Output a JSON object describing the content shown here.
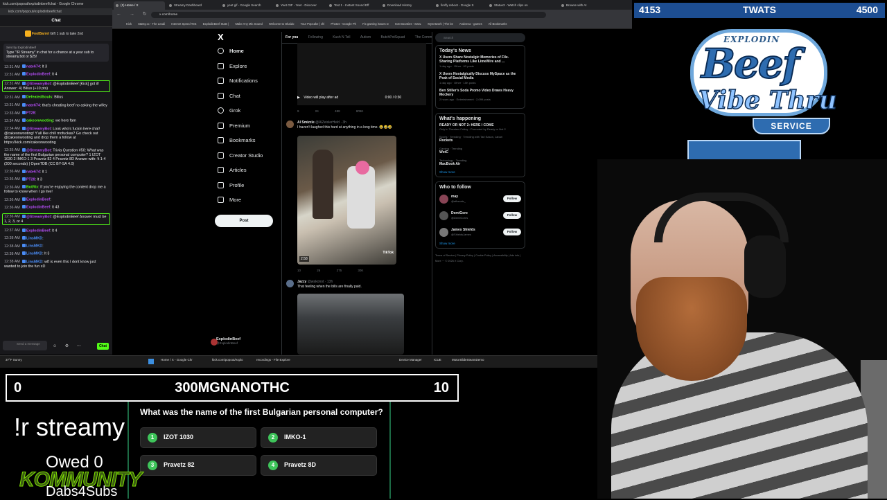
{
  "overlay": {
    "top_left_score": "4153",
    "top_title": "TWATS",
    "top_right_score": "4500",
    "logo": {
      "top": "EXPLODIN",
      "main": "Beef",
      "sub": "Vibe Thru",
      "service": "SERVICE"
    },
    "trivia_left_score": "0",
    "trivia_title": "300MGNANOTHC",
    "trivia_right_score": "10",
    "question": "What was the name of the first Bulgarian personal computer?",
    "answers": [
      {
        "num": "1",
        "text": "IZOT 1030"
      },
      {
        "num": "2",
        "text": "IMKO-1"
      },
      {
        "num": "3",
        "text": "Pravetz 82"
      },
      {
        "num": "4",
        "text": "Pravetz 8D"
      }
    ],
    "command": "!r streamy",
    "owed": "Owed 0",
    "kommunity": "KOMMUNITY",
    "dabs": "Dabs4Subs"
  },
  "chat_window": {
    "tab_title": "kick.com/popout/explodinbeef/chat - Google Chrome",
    "url": "kick.com/popout/explodinbeef/chat",
    "title": "Chat",
    "gift": {
      "user": "FoolBarrel",
      "text": "Gift 1 sub to take 2nd"
    },
    "pinned": {
      "by": "Sent by ExplodinBeef",
      "text": "Type \"!R Streamy\" in chat for a chance at a year sub to streamy.bot or $25!"
    },
    "messages": [
      {
        "time": "12:31 AM",
        "user": "nate674",
        "text": ": lt 3",
        "color": "#b14cf0"
      },
      {
        "time": "12:31 AM",
        "user": "ExplodinBeef",
        "text": ": lt 4",
        "color": "#b14cf0"
      },
      {
        "time": "12:31 AM",
        "user": "@StreamyBot",
        "text": ": @ExplodinBeef [Kick] got it! Answer: 4) Bilius (+10 pts)",
        "color": "#b14cf0"
      },
      {
        "time": "12:31 AM",
        "user": "DefeatedSouls",
        "text": ": Bilius",
        "color": "#53fc18"
      },
      {
        "time": "12:31 AM",
        "user": "nate674",
        "text": ": that's cheating beef no asking the wifey",
        "color": "#b14cf0"
      },
      {
        "time": "12:33 AM",
        "user": "PT28",
        "text": ":",
        "color": "#b14cf0"
      },
      {
        "time": "12:34 AM",
        "user": "cakeonwooting",
        "text": ": we here fam",
        "color": "#53fc18"
      },
      {
        "time": "12:34 AM",
        "user": "@StreamyBot",
        "text": ": Look who's fuckin here chat! @cakeonwooting! Y'all like chill mofuckas? Go check out @cakeonwooting and drop them a follow at https://kick.com/cakeonwooting",
        "color": "#b14cf0"
      },
      {
        "time": "12:35 AM",
        "user": "@StreamyBot",
        "text": ": Trivia Question #50: What was the name of the first Bulgarian personal computer? 1 IZOT 1030 2 IMKO-1 3 Pravetz 82 4 Pravetz 8D Answer with: !t 1-4 (300 seconds) | OpenTDB (CC BY-SA 4.0)",
        "color": "#b14cf0"
      },
      {
        "time": "12:36 AM",
        "user": "nate674",
        "text": ": lt 1",
        "color": "#b14cf0"
      },
      {
        "time": "12:36 AM",
        "user": "PT28",
        "text": ": lt 3",
        "color": "#b14cf0"
      },
      {
        "time": "12:36 AM",
        "user": "BotRix",
        "text": ": If you're enjoying the content drop me a follow to know when I go live!",
        "color": "#53fc18"
      },
      {
        "time": "12:36 AM",
        "user": "ExplodinBeef",
        "text": ":",
        "color": "#b14cf0"
      },
      {
        "time": "12:36 AM",
        "user": "ExplodinBeef",
        "text": ": lt 43",
        "color": "#b14cf0"
      },
      {
        "time": "12:36 AM",
        "user": "@StreamyBot",
        "text": ": @ExplodinBeef Answer must be 1, 2, 3, or 4",
        "color": "#b14cf0"
      },
      {
        "time": "12:37 AM",
        "user": "ExplodinBeef",
        "text": ": lt 4",
        "color": "#b14cf0"
      },
      {
        "time": "12:38 AM",
        "user": "LinsMKD",
        "text": ":",
        "color": "#4a8cf5"
      },
      {
        "time": "12:38 AM",
        "user": "LinsMKD",
        "text": ":",
        "color": "#4a8cf5"
      },
      {
        "time": "12:38 AM",
        "user": "LinsMKD",
        "text": ": lt 3",
        "color": "#4a8cf5"
      },
      {
        "time": "12:38 AM",
        "user": "LinsMKD",
        "text": ": wtf is even this I dont know just wanted to join the fun xD",
        "color": "#4a8cf5"
      }
    ],
    "input_placeholder": "Send a message",
    "chat_button": "Chat"
  },
  "browser": {
    "tabs": [
      "(1) Home / X",
      "Streamy Dashboard",
      "yeet gif - Google Search",
      "Yeet GIF - Yeet - Discover",
      "Test 1 - Instant Sound Eff",
      "Download History",
      "firefly reboot - Google S",
      "Statue3 - Watch clips on",
      "Browse with AI"
    ],
    "url": "x.com/home",
    "bookmarks": [
      "Kick",
      "Statsy.cc - The Leadi",
      "Internet Speed Test",
      "ExplodinBeef Stats |",
      "Make Any Mic Sound",
      "Welcome to Okaido",
      "Your Popcake | chl",
      "Photos - Google Ph",
      "Fix gaming issues w",
      "ICE Bounties - www.",
      "Mynetwork | The be",
      "Andeeva - games",
      "All Bookmarks"
    ]
  },
  "x_nav": {
    "logo": "X",
    "items": [
      "Home",
      "Explore",
      "Notifications",
      "Chat",
      "Grok",
      "Premium",
      "Bookmarks",
      "Creator Studio",
      "Articles",
      "Profile",
      "More"
    ],
    "post": "Post",
    "profile_name": "ExplodinBeef",
    "profile_handle": "@ExplodinBeef"
  },
  "feed": {
    "tabs": [
      "For you",
      "Following",
      "Kush N Tell",
      "Autism",
      "ButchPotSquad",
      "The Comm"
    ],
    "video_note": "Video will play after ad",
    "video_time": "0:00 / 0:30",
    "actions1": [
      "9",
      "24",
      "488",
      "805K"
    ],
    "tweet1": {
      "name": "Al Smizzle",
      "handle": "@AlZeislerHeld · 3h",
      "text": "I haven't laughed this hard at anything in a long time. 😂😂😂",
      "duration": "2:58",
      "tiktok": "TikTok"
    },
    "actions2": [
      "10",
      "26",
      "275",
      "30K"
    ],
    "tweet2": {
      "name": "Jazzy",
      "handle": "@wakonot · 13h",
      "text": "That feeling when the bills are finally paid."
    }
  },
  "right_col": {
    "search": "Search",
    "news_title": "Today's News",
    "news": [
      {
        "title": "X Users Share Nostalgic Memories of File-Sharing Platforms Like LimeWire and ...",
        "meta": "1 day ago · Other · 63 posts"
      },
      {
        "title": "X Users Nostalgically Discuss MySpace as the Peak of Social Media",
        "meta": "1 day ago · Other · 15K posts"
      },
      {
        "title": "Ben Stiller's Soda Promo Video Draws Heavy Mockery",
        "meta": "2 hours ago · Entertainment · 2,099 posts"
      }
    ],
    "happening_title": "What's happening",
    "trends": [
      {
        "sub": "Only in Theaters Friday · Promoted by Ready or Not 2",
        "name": "READY OR NOT 2: HERE I COME"
      },
      {
        "sub": "Sports · Trending · Trending with Tari Eason, Jabari",
        "name": "Rockets"
      },
      {
        "sub": "Gaming · Trending",
        "name": "WotC"
      },
      {
        "sub": "Technology · Trending",
        "name": "MacBook Air"
      }
    ],
    "show_more": "Show more",
    "follow_title": "Who to follow",
    "follow": [
      {
        "name": "may",
        "handle": "@afkscale_"
      },
      {
        "name": "DemiGore",
        "handle": "@DemiGores"
      },
      {
        "name": "James Shields",
        "handle": "@ShieldsJames"
      }
    ],
    "follow_label": "Follow",
    "footer": "Terms of Service | Privacy Policy | Cookie Policy | Accessibility | Ads info | More ··· © 2026 X Corp."
  },
  "taskbar": {
    "weather": "37°F Sunny",
    "apps": [
      "Home / X - Google Chr",
      "kick.com/popout/explo",
      "recordings - File Explore",
      "Device Manager",
      "ICUE",
      "MotorSlideSteamDemo"
    ]
  }
}
